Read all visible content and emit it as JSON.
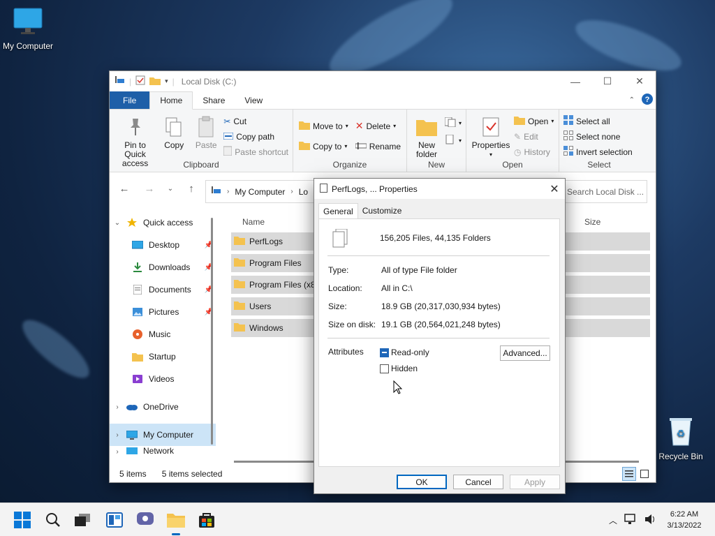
{
  "desktop": {
    "icons": [
      {
        "label": "My Computer",
        "icon": "monitor-icon"
      },
      {
        "label": "Recycle Bin",
        "icon": "recycle-bin-icon"
      }
    ]
  },
  "explorer": {
    "title": "Local Disk (C:)",
    "tabs": [
      "File",
      "Home",
      "Share",
      "View"
    ],
    "active_tab": "Home",
    "ribbon": {
      "clipboard": {
        "label": "Clipboard",
        "pin": "Pin to Quick access",
        "copy": "Copy",
        "paste": "Paste",
        "cut": "Cut",
        "copy_path": "Copy path",
        "paste_shortcut": "Paste shortcut"
      },
      "organize": {
        "label": "Organize",
        "move_to": "Move to",
        "copy_to": "Copy to",
        "delete": "Delete",
        "rename": "Rename"
      },
      "new": {
        "label": "New",
        "new_folder": "New folder"
      },
      "open": {
        "label": "Open",
        "properties": "Properties",
        "open": "Open",
        "edit": "Edit",
        "history": "History"
      },
      "select": {
        "label": "Select",
        "select_all": "Select all",
        "select_none": "Select none",
        "invert": "Invert selection"
      }
    },
    "address": {
      "path": [
        "My Computer",
        "Lo"
      ],
      "search_placeholder": "Search Local Disk ..."
    },
    "nav": [
      {
        "label": "Quick access",
        "icon": "star-icon",
        "level": 0,
        "expanded": true
      },
      {
        "label": "Desktop",
        "icon": "desktop-icon",
        "level": 1,
        "pinned": true
      },
      {
        "label": "Downloads",
        "icon": "download-icon",
        "level": 1,
        "pinned": true
      },
      {
        "label": "Documents",
        "icon": "document-icon",
        "level": 1,
        "pinned": true
      },
      {
        "label": "Pictures",
        "icon": "pictures-icon",
        "level": 1,
        "pinned": true
      },
      {
        "label": "Music",
        "icon": "music-icon",
        "level": 1
      },
      {
        "label": "Startup",
        "icon": "folder-icon",
        "level": 1
      },
      {
        "label": "Videos",
        "icon": "videos-icon",
        "level": 1
      },
      {
        "label": "OneDrive",
        "icon": "cloud-icon",
        "level": 0
      },
      {
        "label": "My Computer",
        "icon": "monitor-icon",
        "level": 0,
        "selected": true
      },
      {
        "label": "Network",
        "icon": "network-icon",
        "level": 0
      }
    ],
    "columns": {
      "name": "Name",
      "size": "Size"
    },
    "files": [
      "PerfLogs",
      "Program Files",
      "Program Files (x86)",
      "Users",
      "Windows"
    ],
    "status": {
      "count": "5 items",
      "selected": "5 items selected"
    }
  },
  "dialog": {
    "title": "PerfLogs, ... Properties",
    "tabs": [
      "General",
      "Customize"
    ],
    "summary": "156,205 Files, 44,135 Folders",
    "type_label": "Type:",
    "type_value": "All of type File folder",
    "location_label": "Location:",
    "location_value": "All in C:\\",
    "size_label": "Size:",
    "size_value": "18.9 GB (20,317,030,934 bytes)",
    "size_on_disk_label": "Size on disk:",
    "size_on_disk_value": "19.1 GB (20,564,021,248 bytes)",
    "attributes_label": "Attributes",
    "readonly_label": "Read-only",
    "hidden_label": "Hidden",
    "advanced_label": "Advanced...",
    "ok": "OK",
    "cancel": "Cancel",
    "apply": "Apply"
  },
  "taskbar": {
    "time": "6:22 AM",
    "date": "3/13/2022"
  },
  "colors": {
    "accent": "#0067c0",
    "file_tab": "#1e5fa8",
    "folder": "#f4c24f",
    "selection": "#d9d9d9"
  }
}
